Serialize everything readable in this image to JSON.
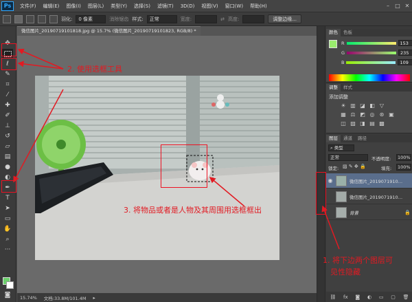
{
  "menubar": {
    "logo": "Ps",
    "items": [
      "文件(F)",
      "编辑(E)",
      "图像(I)",
      "图层(L)",
      "类型(Y)",
      "选择(S)",
      "滤镜(T)",
      "3D(D)",
      "视图(V)",
      "窗口(W)",
      "帮助(H)"
    ]
  },
  "options": {
    "feather_label": "羽化:",
    "feather_value": "0 像素",
    "antialias_label": "消除锯齿",
    "style_label": "样式:",
    "style_value": "正常",
    "width_label": "宽度:",
    "height_label": "高度:",
    "refine_button": "调整边缘..."
  },
  "document": {
    "tab_title": "微信图片_20190719101818.jpg @ 15.7% (微信图片_20190719101823, RGB/8) *",
    "zoom": "15.74%",
    "doc_size": "文档:33.8M/101.4M"
  },
  "color_panel": {
    "tabs": [
      "颜色",
      "色板"
    ],
    "r_label": "R",
    "r_value": "153",
    "g_label": "G",
    "g_value": "235",
    "b_label": "B",
    "b_value": "109",
    "fg_color": "#99eb6d"
  },
  "adjust_panel": {
    "tabs": [
      "调整",
      "样式"
    ],
    "title": "添加调整"
  },
  "layers_panel": {
    "tabs": [
      "图层",
      "通道",
      "路径"
    ],
    "filter_label": "类型",
    "blend_mode": "正常",
    "opacity_label": "不透明度:",
    "opacity_value": "100%",
    "lock_label": "锁定:",
    "fill_label": "填充:",
    "fill_value": "100%",
    "layers": [
      {
        "name": "微信图片_20190719101...",
        "visible": true,
        "selected": true
      },
      {
        "name": "微信图片_20190719101...",
        "visible": false,
        "selected": false
      },
      {
        "name": "背景",
        "visible": false,
        "selected": false
      }
    ]
  },
  "annotations": {
    "step1": "1. 将下边两个图层可见性隐藏",
    "step1_line1": "1. 将下边两个图层可",
    "step1_line2": "见性隐藏",
    "step2": "2. 使用选框工具",
    "step3": "3. 将物品或者是人物及其周围用选框框出"
  },
  "colors": {
    "annotation_red": "#e21a22",
    "selected_layer": "#5a6e8c"
  }
}
